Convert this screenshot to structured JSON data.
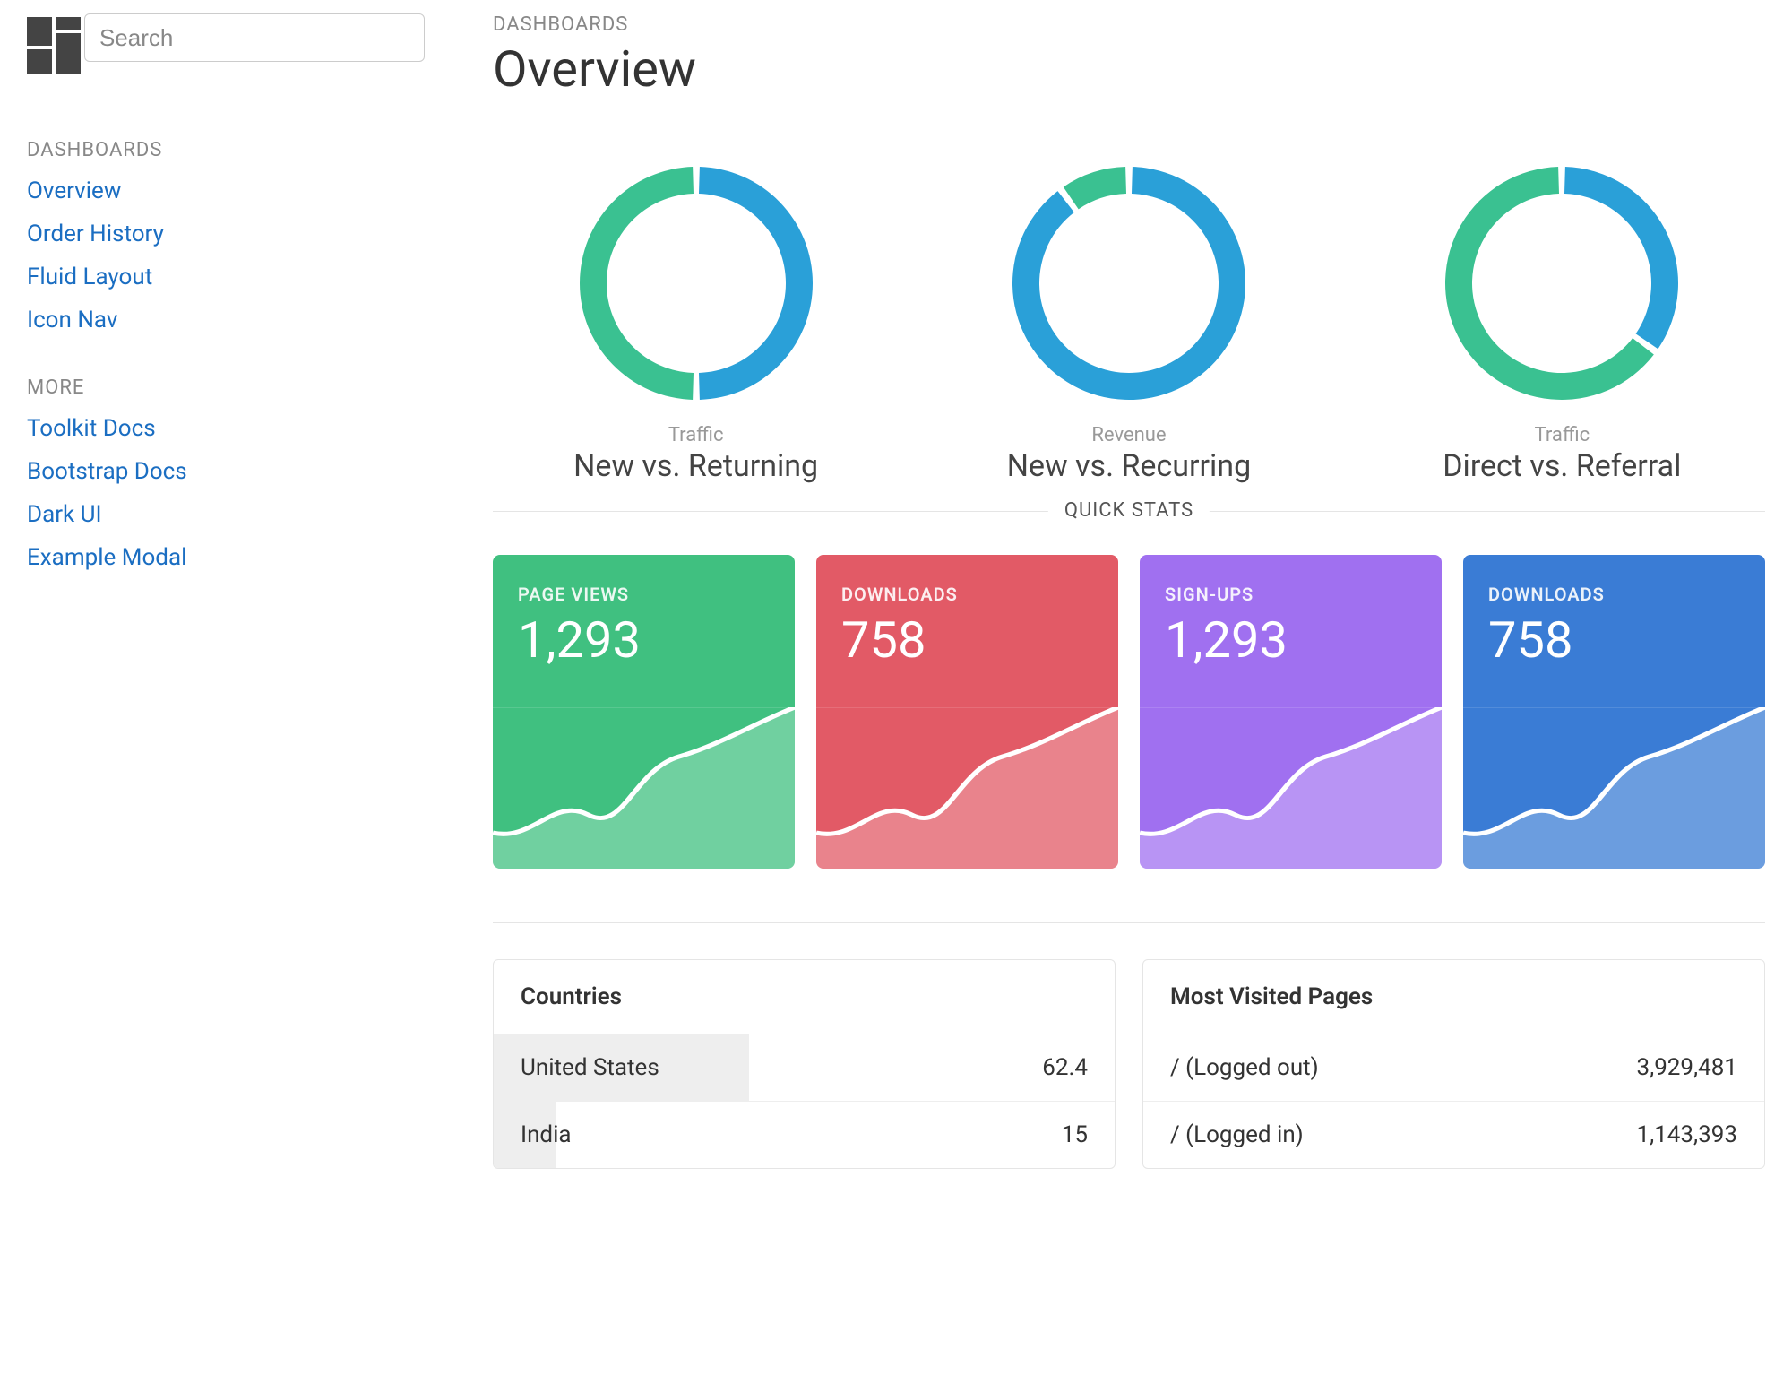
{
  "sidebar": {
    "search_placeholder": "Search",
    "sections": [
      {
        "heading": "DASHBOARDS",
        "items": [
          "Overview",
          "Order History",
          "Fluid Layout",
          "Icon Nav"
        ]
      },
      {
        "heading": "MORE",
        "items": [
          "Toolkit Docs",
          "Bootstrap Docs",
          "Dark UI",
          "Example Modal"
        ]
      }
    ]
  },
  "header": {
    "kicker": "DASHBOARDS",
    "title": "Overview"
  },
  "donuts": [
    {
      "kicker": "Traffic",
      "title": "New vs. Returning"
    },
    {
      "kicker": "Revenue",
      "title": "New vs. Recurring"
    },
    {
      "kicker": "Traffic",
      "title": "Direct vs. Referral"
    }
  ],
  "quick_stats_heading": "QUICK STATS",
  "stat_cards": [
    {
      "label": "PAGE VIEWS",
      "value": "1,293",
      "color": "green"
    },
    {
      "label": "DOWNLOADS",
      "value": "758",
      "color": "red"
    },
    {
      "label": "SIGN-UPS",
      "value": "1,293",
      "color": "purple"
    },
    {
      "label": "DOWNLOADS",
      "value": "758",
      "color": "blue"
    }
  ],
  "tables": {
    "countries": {
      "title": "Countries",
      "rows": [
        {
          "name": "United States",
          "value": "62.4",
          "bar_pct": 62.4
        },
        {
          "name": "India",
          "value": "15",
          "bar_pct": 15
        }
      ]
    },
    "pages": {
      "title": "Most Visited Pages",
      "rows": [
        {
          "name": "/ (Logged out)",
          "value": "3,929,481"
        },
        {
          "name": "/ (Logged in)",
          "value": "1,143,393"
        }
      ]
    }
  },
  "chart_data": [
    {
      "type": "pie",
      "title": "Traffic — New vs. Returning",
      "series": [
        {
          "name": "New",
          "value": 50
        },
        {
          "name": "Returning",
          "value": 50
        }
      ],
      "colors": [
        "#2aa0d8",
        "#3ac191"
      ]
    },
    {
      "type": "pie",
      "title": "Revenue — New vs. Recurring",
      "series": [
        {
          "name": "New",
          "value": 90
        },
        {
          "name": "Recurring",
          "value": 10
        }
      ],
      "colors": [
        "#2aa0d8",
        "#3ac191"
      ]
    },
    {
      "type": "pie",
      "title": "Traffic — Direct vs. Referral",
      "series": [
        {
          "name": "Direct",
          "value": 35
        },
        {
          "name": "Referral",
          "value": 65
        }
      ],
      "colors": [
        "#2aa0d8",
        "#3ac191"
      ]
    }
  ],
  "colors": {
    "blue_series": "#2aa0d8",
    "green_series": "#3ac191"
  }
}
